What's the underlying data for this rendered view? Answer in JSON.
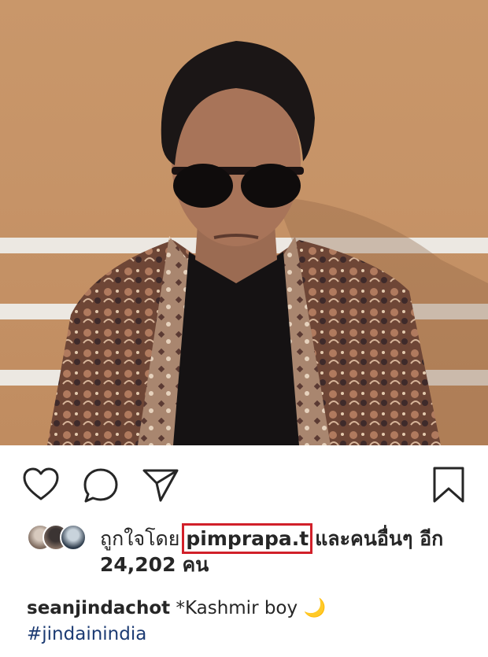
{
  "post": {
    "actions": {
      "like_icon": "heart-icon",
      "comment_icon": "comment-icon",
      "share_icon": "paper-plane-icon",
      "save_icon": "bookmark-icon"
    },
    "likes": {
      "prefix": "ถูกใจโดย",
      "highlighted_user": "pimprapa.t",
      "suffix": "และคนอื่นๆ อีก",
      "count": "24,202",
      "count_unit": "คน",
      "highlight_color": "#d1202a"
    },
    "caption": {
      "username": "seanjindachot",
      "text": "*Kashmir boy",
      "emoji": "🌙",
      "hashtag": "#jindainindia"
    }
  }
}
